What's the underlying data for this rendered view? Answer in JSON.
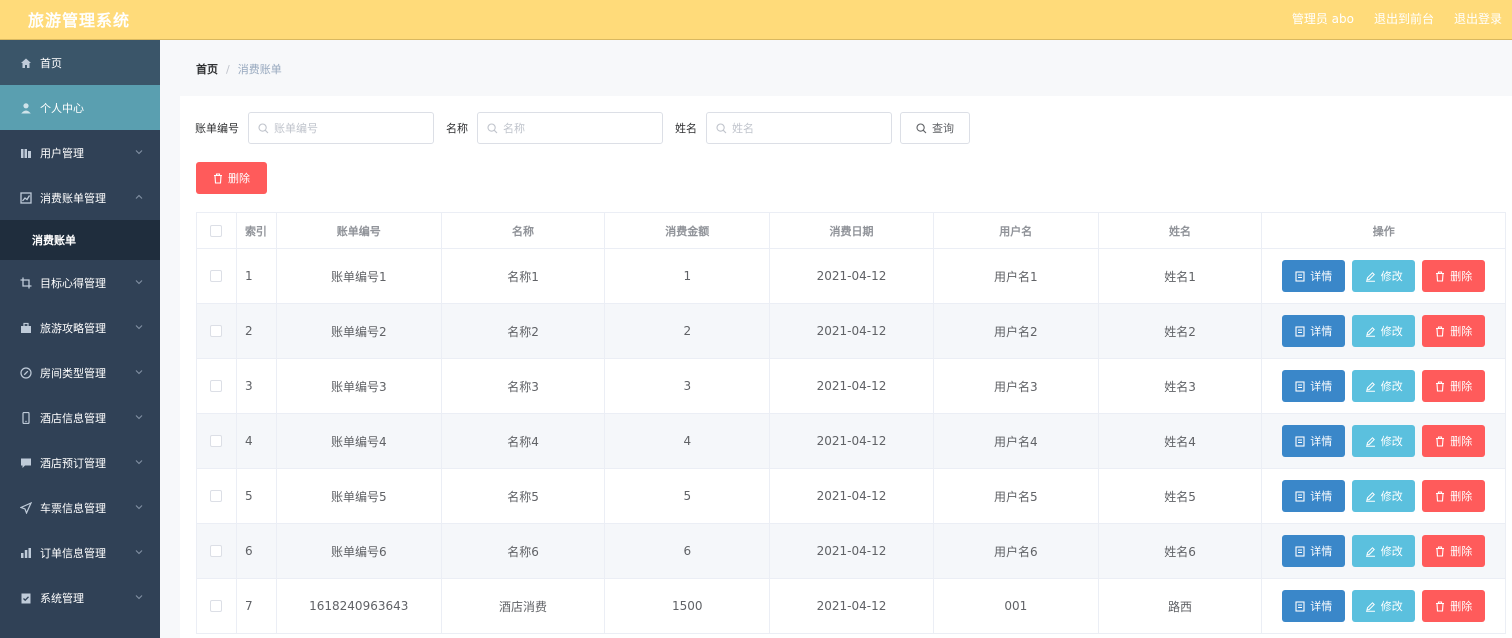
{
  "header": {
    "title": "旅游管理系统",
    "admin": "管理员 abo",
    "front": "退出到前台",
    "logout": "退出登录"
  },
  "sidebar": {
    "items": [
      {
        "label": "首页",
        "icon": "home-icon"
      },
      {
        "label": "个人中心",
        "icon": "user-icon"
      },
      {
        "label": "用户管理",
        "icon": "users-icon"
      },
      {
        "label": "消费账单管理",
        "icon": "chart-icon"
      },
      {
        "label": "消费账单",
        "icon": ""
      },
      {
        "label": "目标心得管理",
        "icon": "crop-icon"
      },
      {
        "label": "旅游攻略管理",
        "icon": "briefcase-icon"
      },
      {
        "label": "房间类型管理",
        "icon": "compass-icon"
      },
      {
        "label": "酒店信息管理",
        "icon": "phone-icon"
      },
      {
        "label": "酒店预订管理",
        "icon": "message-icon"
      },
      {
        "label": "车票信息管理",
        "icon": "send-icon"
      },
      {
        "label": "订单信息管理",
        "icon": "bar-chart-icon"
      },
      {
        "label": "系统管理",
        "icon": "clipboard-icon"
      }
    ]
  },
  "breadcrumb": {
    "home": "首页",
    "separator": "/",
    "current": "消费账单"
  },
  "search": {
    "fields": [
      {
        "label": "账单编号",
        "placeholder": "账单编号"
      },
      {
        "label": "名称",
        "placeholder": "名称"
      },
      {
        "label": "姓名",
        "placeholder": "姓名"
      }
    ],
    "button": "查询"
  },
  "actions": {
    "delete": "删除"
  },
  "table": {
    "columns": [
      "索引",
      "账单编号",
      "名称",
      "消费金额",
      "消费日期",
      "用户名",
      "姓名",
      "操作"
    ],
    "rows": [
      [
        "1",
        "账单编号1",
        "名称1",
        "1",
        "2021-04-12",
        "用户名1",
        "姓名1"
      ],
      [
        "2",
        "账单编号2",
        "名称2",
        "2",
        "2021-04-12",
        "用户名2",
        "姓名2"
      ],
      [
        "3",
        "账单编号3",
        "名称3",
        "3",
        "2021-04-12",
        "用户名3",
        "姓名3"
      ],
      [
        "4",
        "账单编号4",
        "名称4",
        "4",
        "2021-04-12",
        "用户名4",
        "姓名4"
      ],
      [
        "5",
        "账单编号5",
        "名称5",
        "5",
        "2021-04-12",
        "用户名5",
        "姓名5"
      ],
      [
        "6",
        "账单编号6",
        "名称6",
        "6",
        "2021-04-12",
        "用户名6",
        "姓名6"
      ],
      [
        "7",
        "1618240963643",
        "酒店消费",
        "1500",
        "2021-04-12",
        "001",
        "路西"
      ]
    ],
    "row_actions": {
      "detail": "详情",
      "edit": "修改",
      "delete": "删除"
    }
  },
  "colors": {
    "header_bg": "#ffdb7a",
    "sidebar_bg": "#304156",
    "active_menu": "#5a9fb0",
    "detail_btn": "#3a87c9",
    "edit_btn": "#5bc0de",
    "delete_btn": "#ff5b5b"
  }
}
